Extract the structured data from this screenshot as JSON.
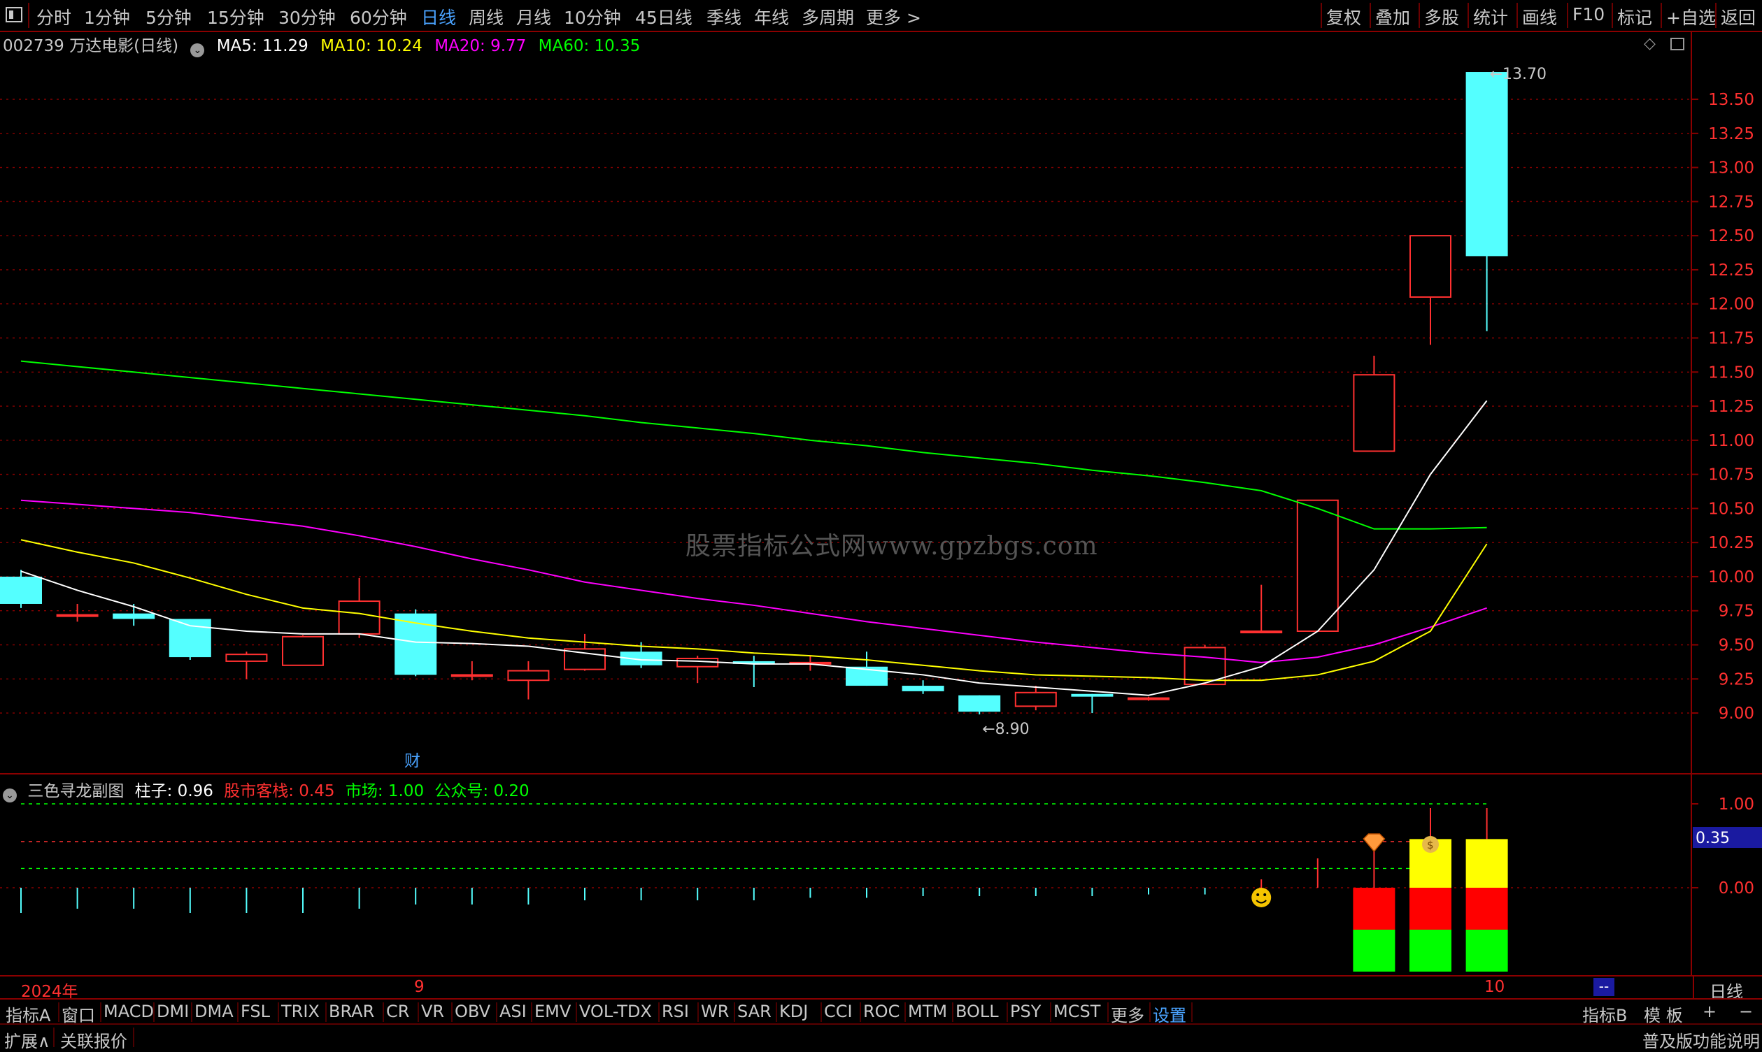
{
  "toolbar": {
    "left_items": [
      "分时",
      "1分钟",
      "5分钟",
      "15分钟",
      "30分钟",
      "60分钟",
      "日线",
      "周线",
      "月线",
      "10分钟",
      "45日线",
      "季线",
      "年线",
      "多周期",
      "更多 >"
    ],
    "active": "日线",
    "right_items": [
      "复权",
      "叠加",
      "多股",
      "统计",
      "画线",
      "F10",
      "标记",
      "+自选",
      "返回"
    ]
  },
  "stock": {
    "code_name": "002739 万达电影(日线)",
    "ma5": "MA5: 11.29",
    "ma10": "MA10: 10.24",
    "ma20": "MA20: 9.77",
    "ma60": "MA60: 10.35"
  },
  "colors": {
    "ma5": "#ffffff",
    "ma10": "#ffff00",
    "ma20": "#ff00ff",
    "ma60": "#00ff00",
    "up": "#ff3030",
    "down": "#54ffff",
    "grid": "#8b0000"
  },
  "price_axis": {
    "ticks": [
      "13.50",
      "13.25",
      "13.00",
      "12.75",
      "12.50",
      "12.25",
      "12.00",
      "11.75",
      "11.50",
      "11.25",
      "11.00",
      "10.75",
      "10.50",
      "10.25",
      "10.00",
      "9.75",
      "9.50",
      "9.25",
      "9.00"
    ],
    "max_label": "13.70",
    "min_label": "8.90"
  },
  "chart_data": {
    "type": "candlestick",
    "ylim": [
      8.78,
      13.9
    ],
    "candles": [
      {
        "o": 10.0,
        "h": 10.05,
        "l": 9.77,
        "c": 9.8
      },
      {
        "o": 9.72,
        "h": 9.8,
        "l": 9.67,
        "c": 9.72
      },
      {
        "o": 9.73,
        "h": 9.8,
        "l": 9.64,
        "c": 9.69
      },
      {
        "o": 9.69,
        "h": 9.69,
        "l": 9.39,
        "c": 9.41
      },
      {
        "o": 9.38,
        "h": 9.45,
        "l": 9.25,
        "c": 9.43
      },
      {
        "o": 9.35,
        "h": 9.57,
        "l": 9.35,
        "c": 9.56
      },
      {
        "o": 9.58,
        "h": 9.99,
        "l": 9.55,
        "c": 9.82
      },
      {
        "o": 9.73,
        "h": 9.76,
        "l": 9.27,
        "c": 9.28
      },
      {
        "o": 9.28,
        "h": 9.38,
        "l": 9.24,
        "c": 9.28
      },
      {
        "o": 9.24,
        "h": 9.38,
        "l": 9.1,
        "c": 9.31
      },
      {
        "o": 9.32,
        "h": 9.58,
        "l": 9.31,
        "c": 9.47
      },
      {
        "o": 9.45,
        "h": 9.52,
        "l": 9.33,
        "c": 9.35
      },
      {
        "o": 9.34,
        "h": 9.42,
        "l": 9.22,
        "c": 9.4
      },
      {
        "o": 9.38,
        "h": 9.42,
        "l": 9.19,
        "c": 9.36
      },
      {
        "o": 9.37,
        "h": 9.42,
        "l": 9.31,
        "c": 9.37
      },
      {
        "o": 9.34,
        "h": 9.45,
        "l": 9.2,
        "c": 9.2
      },
      {
        "o": 9.2,
        "h": 9.24,
        "l": 9.14,
        "c": 9.16
      },
      {
        "o": 9.13,
        "h": 9.13,
        "l": 8.99,
        "c": 9.01
      },
      {
        "o": 9.05,
        "h": 9.2,
        "l": 9.02,
        "c": 9.15
      },
      {
        "o": 9.14,
        "h": 9.14,
        "l": 9.0,
        "c": 9.12
      },
      {
        "o": 9.1,
        "h": 9.12,
        "l": 9.09,
        "c": 9.11
      },
      {
        "o": 9.21,
        "h": 9.5,
        "l": 9.21,
        "c": 9.48
      },
      {
        "o": 9.6,
        "h": 9.94,
        "l": 9.6,
        "c": 9.6
      },
      {
        "o": 9.6,
        "h": 10.56,
        "l": 9.6,
        "c": 10.56
      },
      {
        "o": 10.92,
        "h": 11.62,
        "l": 10.92,
        "c": 11.48
      },
      {
        "o": 12.05,
        "h": 12.5,
        "l": 11.7,
        "c": 12.5
      },
      {
        "o": 13.7,
        "h": 13.7,
        "l": 11.8,
        "c": 12.35
      }
    ],
    "ma5": [
      10.04,
      9.9,
      9.78,
      9.64,
      9.6,
      9.58,
      9.58,
      9.52,
      9.51,
      9.49,
      9.44,
      9.39,
      9.38,
      9.36,
      9.36,
      9.32,
      9.28,
      9.22,
      9.19,
      9.16,
      9.13,
      9.22,
      9.34,
      9.6,
      10.05,
      10.75,
      11.29
    ],
    "ma10": [
      10.27,
      10.18,
      10.1,
      9.99,
      9.87,
      9.77,
      9.73,
      9.66,
      9.6,
      9.55,
      9.52,
      9.49,
      9.47,
      9.44,
      9.42,
      9.39,
      9.35,
      9.31,
      9.28,
      9.27,
      9.26,
      9.24,
      9.24,
      9.28,
      9.38,
      9.6,
      10.24
    ],
    "ma20": [
      10.56,
      10.53,
      10.5,
      10.47,
      10.42,
      10.37,
      10.3,
      10.22,
      10.13,
      10.05,
      9.96,
      9.9,
      9.84,
      9.79,
      9.73,
      9.67,
      9.62,
      9.57,
      9.52,
      9.48,
      9.44,
      9.41,
      9.37,
      9.41,
      9.5,
      9.63,
      9.77
    ],
    "ma60": [
      11.58,
      11.54,
      11.5,
      11.46,
      11.42,
      11.38,
      11.34,
      11.3,
      11.26,
      11.22,
      11.18,
      11.13,
      11.09,
      11.05,
      11.0,
      10.96,
      10.91,
      10.87,
      10.83,
      10.78,
      10.74,
      10.69,
      10.63,
      10.5,
      10.35,
      10.35,
      10.36
    ],
    "high_label_index": 26,
    "low_label_index": 17
  },
  "watermark": "股票指标公式网www.gpzbgs.com",
  "cai_marker": "财",
  "sub_indicator": {
    "name": "三色寻龙副图",
    "zhuzi": "柱子: 0.96",
    "gushi": "股市客栈: 0.45",
    "shichang": "市场: 1.00",
    "gongzhong": "公众号: 0.20",
    "axis_ticks": [
      "1.00",
      "0.00"
    ],
    "cursor_value": "0.35",
    "level_lines": [
      1.0,
      0.45,
      0.2
    ],
    "small_bars": [
      -0.3,
      -0.25,
      -0.25,
      -0.3,
      -0.3,
      -0.3,
      -0.25,
      -0.2,
      -0.2,
      -0.2,
      -0.15,
      -0.15,
      -0.15,
      -0.15,
      -0.12,
      -0.12,
      -0.1,
      -0.1,
      -0.1,
      -0.1,
      -0.08,
      -0.08,
      0.1,
      0.35,
      0.45,
      0.95
    ],
    "emoji_index": 22,
    "icons": [
      "smiley-icon",
      "diamond-icon",
      "money-bag-icon"
    ]
  },
  "date_axis": {
    "year_label": "2024年",
    "month_9": "9",
    "month_10": "10",
    "period_label": "日线",
    "dash": "--"
  },
  "tabs": [
    "指标A",
    "窗口",
    "MACD",
    "DMI",
    "DMA",
    "FSL",
    "TRIX",
    "BRAR",
    "CR",
    "VR",
    "OBV",
    "ASI",
    "EMV",
    "VOL-TDX",
    "RSI",
    "WR",
    "SAR",
    "KDJ",
    "CCI",
    "ROC",
    "MTM",
    "BOLL",
    "PSY",
    "MCST",
    "更多",
    "设置"
  ],
  "tabs_right": [
    "指标B",
    "模 板",
    "+",
    "−"
  ],
  "status": {
    "expand": "扩展∧",
    "related": "关联报价",
    "right": "普及版功能说明"
  }
}
